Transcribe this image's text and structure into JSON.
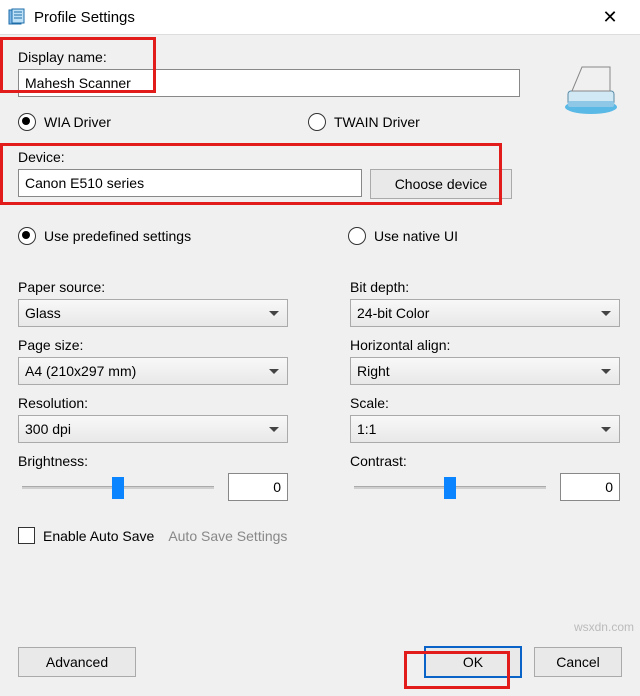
{
  "window": {
    "title": "Profile Settings"
  },
  "displayName": {
    "label": "Display name:",
    "value": "Mahesh Scanner"
  },
  "driver": {
    "wia_label": "WIA Driver",
    "twain_label": "TWAIN Driver",
    "selected": "wia"
  },
  "device": {
    "label": "Device:",
    "value": "Canon E510 series",
    "choose_label": "Choose device"
  },
  "settingsMode": {
    "predefined_label": "Use predefined settings",
    "native_label": "Use native UI",
    "selected": "predefined"
  },
  "left": {
    "paper_source_label": "Paper source:",
    "paper_source_value": "Glass",
    "page_size_label": "Page size:",
    "page_size_value": "A4 (210x297 mm)",
    "resolution_label": "Resolution:",
    "resolution_value": "300 dpi",
    "brightness_label": "Brightness:",
    "brightness_value": "0"
  },
  "right": {
    "bit_depth_label": "Bit depth:",
    "bit_depth_value": "24-bit Color",
    "halign_label": "Horizontal align:",
    "halign_value": "Right",
    "scale_label": "Scale:",
    "scale_value": "1:1",
    "contrast_label": "Contrast:",
    "contrast_value": "0"
  },
  "autosave": {
    "enable_label": "Enable Auto Save",
    "settings_label": "Auto Save Settings"
  },
  "footer": {
    "advanced_label": "Advanced",
    "ok_label": "OK",
    "cancel_label": "Cancel"
  },
  "watermark": "wsxdn.com"
}
